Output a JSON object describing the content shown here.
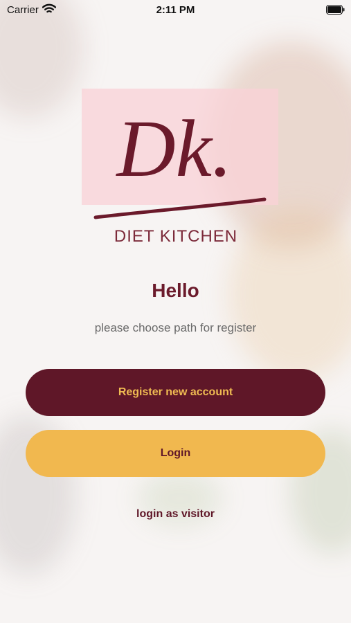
{
  "status_bar": {
    "carrier": "Carrier",
    "time": "2:11 PM",
    "battery_level": 1.0
  },
  "logo": {
    "mark": "Dk.",
    "subtitle": "DIET KITCHEN"
  },
  "main": {
    "title": "Hello",
    "subtitle": "please choose path for register",
    "register_label": "Register new account",
    "login_label": "Login",
    "visitor_label": "login as visitor"
  },
  "colors": {
    "primary": "#5f1728",
    "accent": "#f1b84f"
  },
  "icons": [
    "wifi-icon",
    "battery-icon"
  ]
}
